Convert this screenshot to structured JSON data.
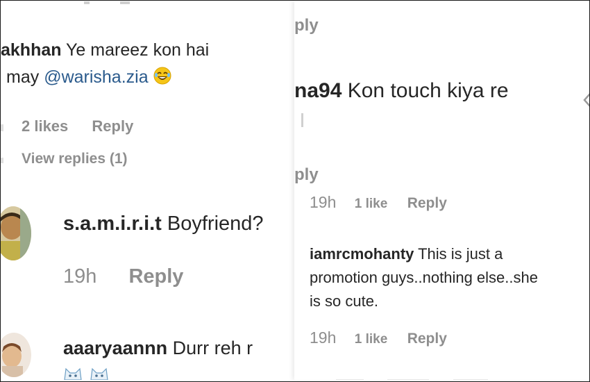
{
  "left": {
    "comment1": {
      "username": "akhhan",
      "text_line1": "Ye mareez kon hai",
      "text_line2_prefix": "may",
      "mention": "@warisha.zia",
      "likes": "2 likes",
      "reply": "Reply",
      "view_replies": "View replies (1)"
    },
    "comment2": {
      "username": "s.a.m.i.r.i.t",
      "text": "Boyfriend?",
      "time": "19h",
      "reply": "Reply"
    },
    "comment3": {
      "username": "aaaryaannn",
      "text": "Durr reh r"
    }
  },
  "right": {
    "top_reply": "ply",
    "comment1": {
      "username": "na94",
      "text": "Kon touch kiya re"
    },
    "mid_reply": "ply",
    "comment2_meta": {
      "time": "19h",
      "likes": "1 like",
      "reply": "Reply"
    },
    "comment3": {
      "username": "iamrcmohanty",
      "text_line1": "This is just a",
      "text_line2": "promotion guys..nothing else..she",
      "text_line3": "is so cute.",
      "time": "19h",
      "likes": "1 like",
      "reply": "Reply"
    }
  },
  "colors": {
    "text": "#262626",
    "meta": "#8e8e8e",
    "mention": "#2a5a8c",
    "emoji": "#f5c518"
  },
  "icons": [
    "laughing-emoji-icon",
    "avatar-samirit",
    "avatar-aaaryaannn",
    "cat-emoji-icon",
    "verified-icon"
  ]
}
